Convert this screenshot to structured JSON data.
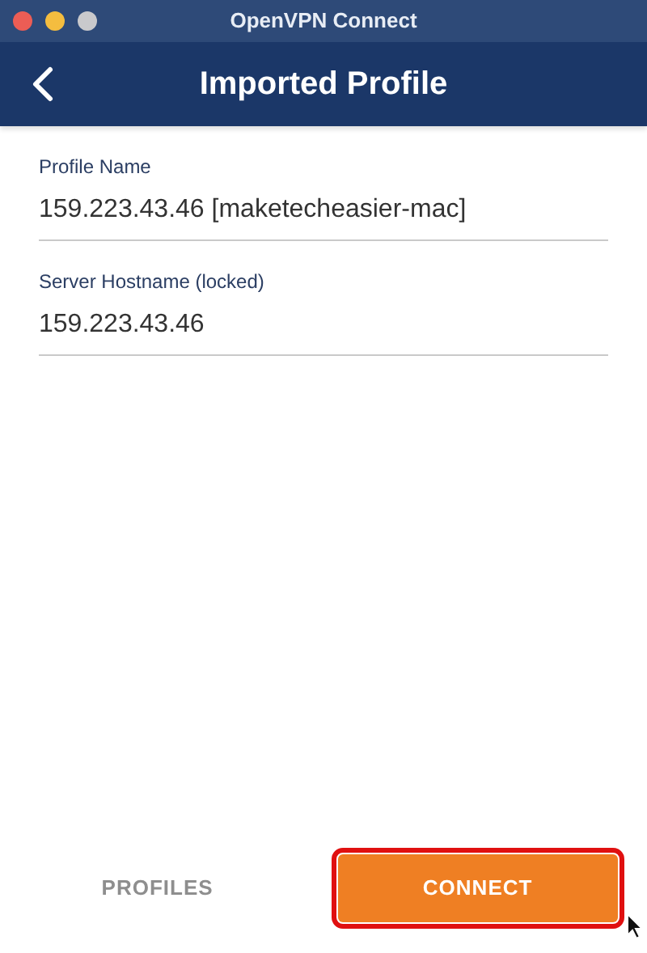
{
  "window": {
    "title": "OpenVPN Connect"
  },
  "header": {
    "title": "Imported Profile"
  },
  "fields": [
    {
      "label": "Profile Name",
      "value": "159.223.43.46 [maketecheasier-mac]"
    },
    {
      "label": "Server Hostname (locked)",
      "value": "159.223.43.46"
    }
  ],
  "buttons": [
    {
      "label": "PROFILES",
      "kind": "secondary",
      "highlighted": false
    },
    {
      "label": "CONNECT",
      "kind": "primary",
      "highlighted": true
    }
  ]
}
